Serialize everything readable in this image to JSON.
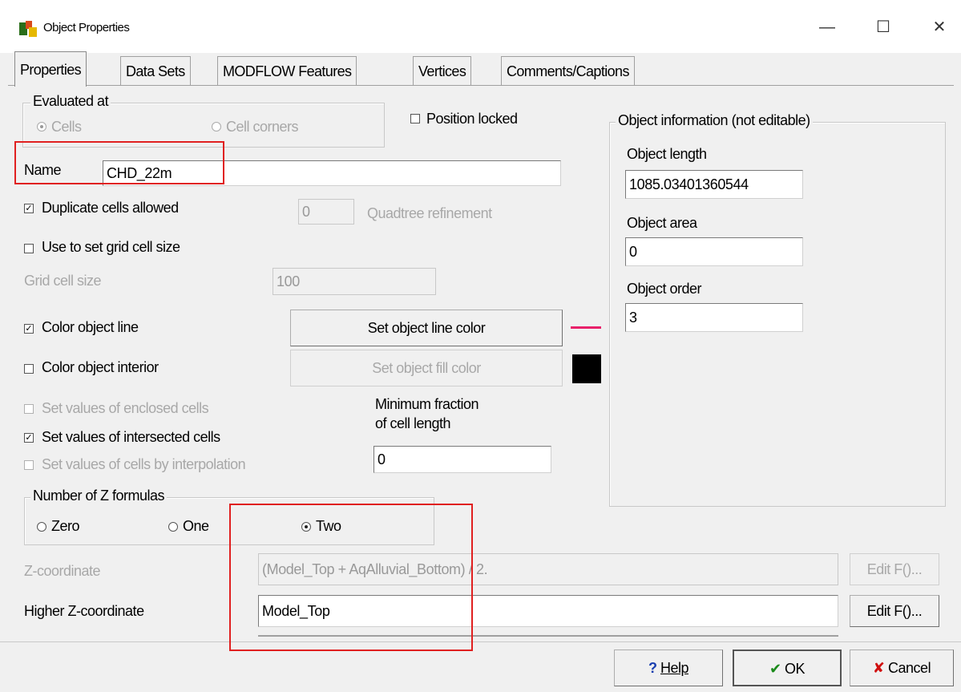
{
  "window": {
    "title": "Object Properties",
    "minimize_glyph": "—",
    "maximize_glyph": "☐",
    "close_glyph": "✕"
  },
  "tabs": [
    {
      "label": "Properties"
    },
    {
      "label": "Data Sets"
    },
    {
      "label": "MODFLOW Features"
    },
    {
      "label": "Vertices"
    },
    {
      "label": "Comments/Captions"
    }
  ],
  "evaluated_at": {
    "title": "Evaluated at",
    "option_cells": "Cells",
    "option_cell_corners": "Cell corners",
    "selected": "Cells"
  },
  "position_locked": {
    "label": "Position locked",
    "checked": false
  },
  "name": {
    "label": "Name",
    "value": "CHD_22m"
  },
  "duplicate_cells": {
    "label": "Duplicate cells allowed",
    "checked": true
  },
  "quadtree": {
    "value": "0",
    "label": "Quadtree refinement"
  },
  "use_grid_cell_size": {
    "label": "Use to set grid cell size",
    "checked": false
  },
  "grid_cell_size": {
    "label": "Grid cell size",
    "value": "100"
  },
  "color_object_line": {
    "label": "Color object line",
    "checked": true,
    "button": "Set object line color",
    "swatch_color": "#e8206a"
  },
  "color_object_interior": {
    "label": "Color object interior",
    "checked": false,
    "button": "Set object fill color",
    "swatch_color": "#000000"
  },
  "enclosed_cells": {
    "label": "Set values of enclosed cells",
    "checked": false
  },
  "intersected_cells": {
    "label": "Set values of intersected cells",
    "checked": true
  },
  "interpolation_cells": {
    "label": "Set values of cells by interpolation",
    "checked": false
  },
  "min_fraction": {
    "label_line1": "Minimum fraction",
    "label_line2": "of cell length",
    "value": "0"
  },
  "z_formulas": {
    "title": "Number of Z formulas",
    "option_zero": "Zero",
    "option_one": "One",
    "option_two": "Two",
    "selected": "Two"
  },
  "z_coordinate": {
    "label": "Z-coordinate",
    "value": "(Model_Top + AqAlluvial_Bottom) / 2.",
    "button": "Edit F()..."
  },
  "higher_z": {
    "label": "Higher Z-coordinate",
    "value": "Model_Top",
    "button": "Edit F()..."
  },
  "object_info": {
    "title": "Object information (not editable)",
    "length_label": "Object length",
    "length_value": "1085.03401360544",
    "area_label": "Object area",
    "area_value": "0",
    "order_label": "Object order",
    "order_value": "3"
  },
  "footer": {
    "help": "Help",
    "ok": "OK",
    "cancel": "Cancel"
  },
  "colors": {
    "highlight_box": "#e02020",
    "ok_check": "#1a8a1a",
    "cancel_x": "#d01010",
    "help_mark": "#1a3fb0"
  }
}
